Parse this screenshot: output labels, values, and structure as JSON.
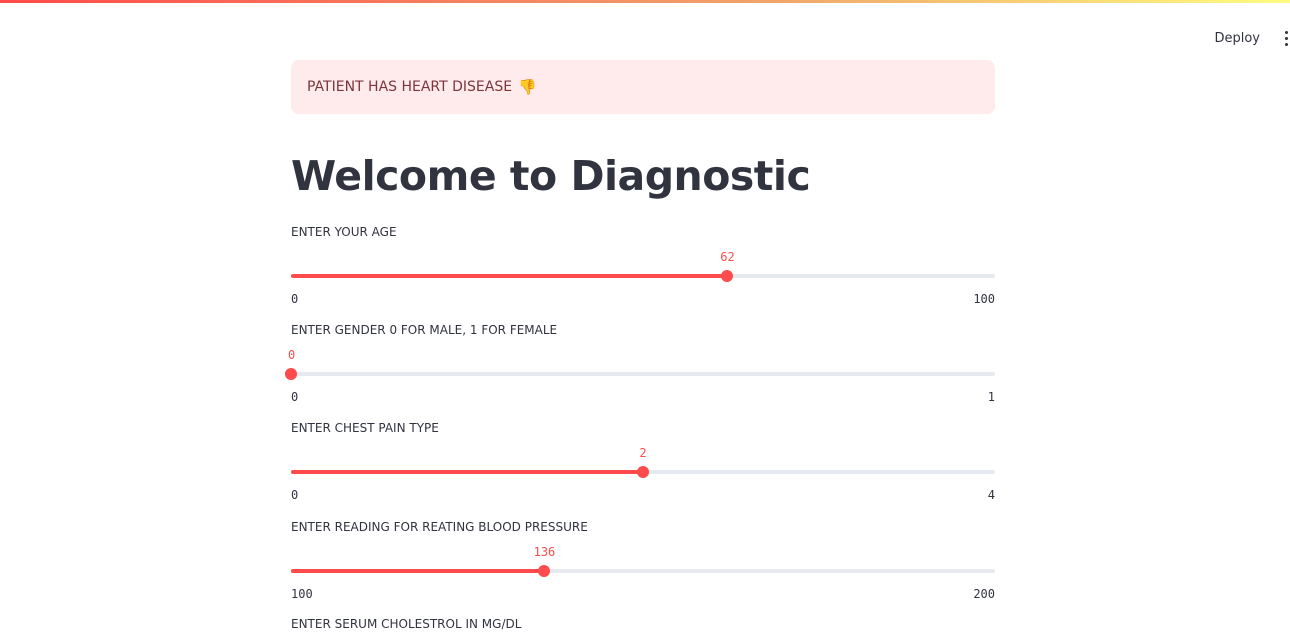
{
  "header": {
    "deploy_label": "Deploy",
    "menu_icon": "kebab-menu-icon"
  },
  "alert": {
    "text": "PATIENT HAS HEART DISEASE",
    "icon": "👎",
    "icon_name": "thumbs-down-icon"
  },
  "title": "Welcome to Diagnostic",
  "sliders": [
    {
      "label": "ENTER YOUR AGE",
      "value": 62,
      "min": 0,
      "max": 100
    },
    {
      "label": "ENTER GENDER 0 FOR MALE, 1 FOR FEMALE",
      "value": 0,
      "min": 0,
      "max": 1
    },
    {
      "label": "ENTER CHEST PAIN TYPE",
      "value": 2,
      "min": 0,
      "max": 4
    },
    {
      "label": "ENTER READING FOR REATING BLOOD PRESSURE",
      "value": 136,
      "min": 100,
      "max": 200
    }
  ],
  "next_label": "ENTER SERUM CHOLESTROL IN MG/DL",
  "colors": {
    "accent": "#ff4b4b",
    "alert_bg": "#ffebeb",
    "alert_text": "#7d353b",
    "track": "#e6e9ef"
  }
}
